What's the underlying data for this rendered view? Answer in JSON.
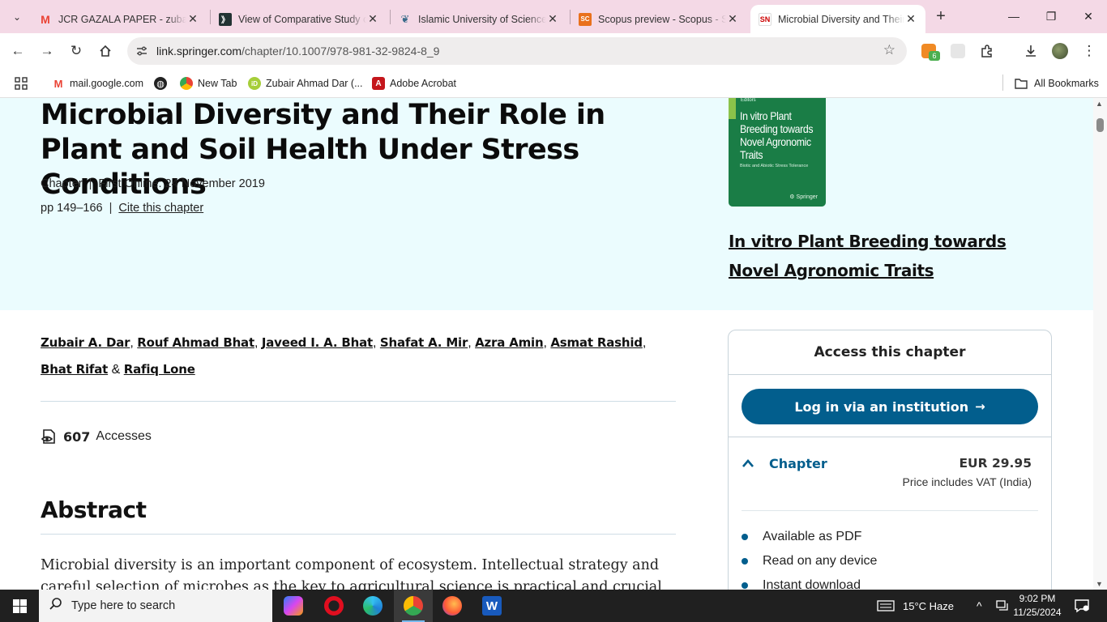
{
  "browser": {
    "tabs": [
      {
        "title": "JCR GAZALA PAPER - zubair.",
        "favicon": "gmail-icon",
        "active": false
      },
      {
        "title": "View of Comparative Study o",
        "favicon": "journal-icon",
        "active": false
      },
      {
        "title": "Islamic University of Science",
        "favicon": "university-icon",
        "active": false
      },
      {
        "title": "Scopus preview - Scopus - S",
        "favicon_text": "SC",
        "active": false
      },
      {
        "title": "Microbial Diversity and Their",
        "favicon_text": "SN",
        "active": true
      }
    ],
    "url_domain": "link.springer.com",
    "url_path": "/chapter/10.1007/978-981-32-9824-8_9",
    "extension_badge": "6",
    "bookmarks": [
      {
        "label": "mail.google.com",
        "icon": "gmail-icon"
      },
      {
        "label": "",
        "icon": "globe-icon"
      },
      {
        "label": "New Tab",
        "icon": "chrome-icon"
      },
      {
        "label": "Zubair Ahmad Dar (...",
        "icon": "orcid-icon",
        "icon_text": "iD"
      },
      {
        "label": "Adobe Acrobat",
        "icon": "acrobat-icon"
      }
    ],
    "all_bookmarks": "All Bookmarks"
  },
  "chapter": {
    "title": "Microbial Diversity and Their Role in Plant and Soil Health Under Stress Conditions",
    "type": "Chapter",
    "first_online": "First Online: 24 November 2019",
    "pages": "pp 149–166",
    "cite": "Cite this chapter",
    "authors": [
      "Zubair A. Dar",
      "Rouf Ahmad Bhat",
      "Javeed I. A. Bhat",
      "Shafat A. Mir",
      "Azra Amin",
      "Asmat Rashid",
      "Bhat Rifat",
      "Rafiq Lone"
    ],
    "author_sep": ",",
    "author_and": "&",
    "accesses_count": "607",
    "accesses_label": "Accesses",
    "abstract_heading": "Abstract",
    "abstract_text": "Microbial diversity is an important component of ecosystem. Intellectual strategy and careful selection of microbes as the key to agricultural science is practical and crucial to"
  },
  "book": {
    "cover_editors": "Editors",
    "cover_title": "In vitro Plant Breeding towards Novel Agronomic Traits",
    "cover_subtitle": "Biotic and Abiotic Stress Tolerance",
    "cover_publisher": "Springer",
    "link_title": "In vitro Plant Breeding towards Novel Agronomic Traits"
  },
  "access": {
    "heading": "Access this chapter",
    "login_button": "Log in via an institution",
    "chapter_label": "Chapter",
    "price": "EUR 29.95",
    "vat": "Price includes VAT (India)",
    "features": [
      "Available as PDF",
      "Read on any device",
      "Instant download"
    ]
  },
  "taskbar": {
    "search_placeholder": "Type here to search",
    "weather": "15°C  Haze",
    "time": "9:02 PM",
    "date": "11/25/2024"
  },
  "colors": {
    "tab_strip": "#f4d9e6",
    "hero_bg": "#ebfcfe",
    "springer_blue": "#025e8d",
    "cover_green": "#1a7d46"
  }
}
